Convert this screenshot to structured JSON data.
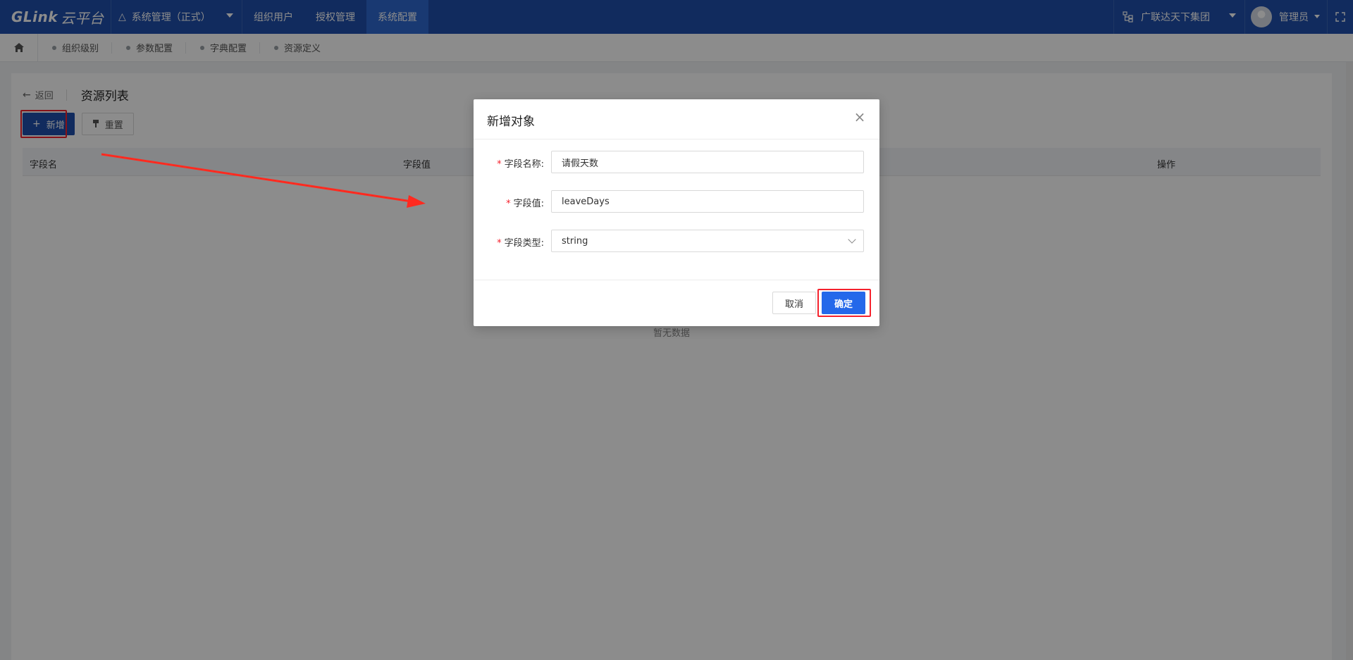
{
  "topbar": {
    "logo_en": "GLink",
    "logo_cn": "云平台",
    "system_label": "系统管理（正式）",
    "nav": [
      {
        "label": "组织用户"
      },
      {
        "label": "授权管理"
      },
      {
        "label": "系统配置"
      }
    ],
    "org_label": "广联达天下集团",
    "user_label": "管理员"
  },
  "tabs": [
    {
      "label": "组织级别"
    },
    {
      "label": "参数配置"
    },
    {
      "label": "字典配置"
    },
    {
      "label": "资源定义"
    }
  ],
  "page": {
    "back_label": "返回",
    "title": "资源列表",
    "add_label": "新增",
    "reset_label": "重置",
    "columns": [
      "字段名",
      "字段值",
      "操作"
    ],
    "empty_text": "暂无数据"
  },
  "modal": {
    "title": "新增对象",
    "fields": [
      {
        "label": "字段名称:",
        "value": "请假天数"
      },
      {
        "label": "字段值:",
        "value": "leaveDays"
      },
      {
        "label": "字段类型:",
        "value": "string"
      }
    ],
    "required_mark": "*",
    "cancel_label": "取消",
    "ok_label": "确定"
  },
  "colors": {
    "brand": "#1f4fab",
    "primary": "#2468ea",
    "highlight": "#f5222d"
  }
}
